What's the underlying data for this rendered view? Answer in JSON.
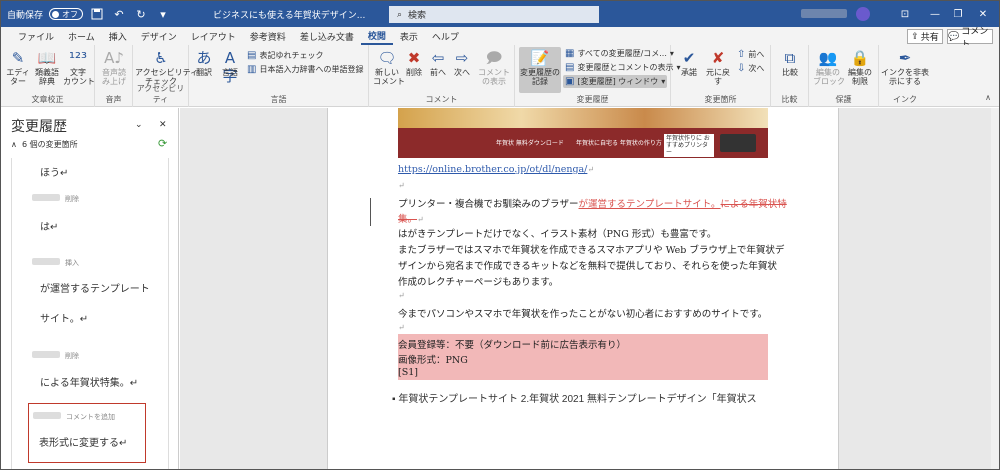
{
  "titlebar": {
    "autosave_label": "自動保存",
    "autosave_state": "オフ",
    "doc_title": "ビジネスにも使える年賀状デザイン...",
    "search_placeholder": "検索"
  },
  "menu": {
    "tabs": [
      "ファイル",
      "ホーム",
      "挿入",
      "デザイン",
      "レイアウト",
      "参考資料",
      "差し込み文書",
      "校閲",
      "表示",
      "ヘルプ"
    ],
    "active": "校閲",
    "share_label": "共有",
    "comment_label": "コメント"
  },
  "ribbon": {
    "proofing": {
      "label": "文章校正",
      "editor": "エディ\nター",
      "thesaurus": "類義語\n辞典",
      "wordcount": "文字\nカウント"
    },
    "speech": {
      "label": "音声",
      "read_aloud": "音声読\nみ上げ"
    },
    "accessibility": {
      "label": "アクセシビリティ",
      "check": "アクセシビリティ\nチェック"
    },
    "language": {
      "label": "言語",
      "translate": "翻訳",
      "language": "言語",
      "notation_check": "表記ゆれチェック",
      "japanese_dict": "日本語入力辞書への単語登録"
    },
    "comments": {
      "label": "コメント",
      "new": "新しい\nコメント",
      "delete": "削除",
      "prev": "前へ",
      "next": "次へ",
      "show": "コメント\nの表示"
    },
    "tracking": {
      "label": "変更履歴",
      "track": "変更履歴の\n記録",
      "all_markup": "すべての変更履歴/コメ...",
      "show_markup": "変更履歴とコメントの表示",
      "window": "[変更履歴] ウィンドウ"
    },
    "changes": {
      "label": "変更箇所",
      "accept": "承諾",
      "reject": "元に戻す",
      "prev": "前へ",
      "next": "次へ"
    },
    "compare": {
      "label": "比較",
      "compare": "比較"
    },
    "protect": {
      "label": "保護",
      "block": "編集の\nブロック",
      "restrict": "編集の\n制限"
    },
    "ink": {
      "label": "インク",
      "hide": "インクを非表\n示にする"
    }
  },
  "pane": {
    "title": "変更履歴",
    "count": "6 個の変更箇所",
    "items": [
      {
        "meta": "",
        "text": "ほう↵"
      },
      {
        "meta": "削除",
        "text": "は↵"
      },
      {
        "meta": "挿入",
        "text": "が運営するテンプレート"
      },
      {
        "meta": "",
        "text": "サイト。↵"
      },
      {
        "meta": "削除",
        "text": "による年賀状特集。↵"
      },
      {
        "meta": "コメントを追加",
        "text": "表形式に変更する↵"
      }
    ]
  },
  "document": {
    "banner": {
      "b1": "年賀状 無料ダウンロード",
      "b2": "年賀状に自宅る 年賀状の作り方",
      "b3": "年賀状作りに おすすめプリンター"
    },
    "link": "https://online.brother.co.jp/ot/dl/nenga/",
    "para1_a": "プリンター・複合機でお馴染みのブラザー",
    "para1_ins": "が運営するテンプレートサイト。",
    "para1_del": "による年賀状特",
    "para1_del2": "集。",
    "para2": "はがきテンプレートだけでなく、イラスト素材（PNG 形式）も豊富です。",
    "para3": "またブラザーではスマホで年賀状を作成できるスマホアプリや Web ブラウザ上で年賀状デ",
    "para4": "ザインから宛名まで作成できるキットなどを無料で提供しており、それらを使った年賀状",
    "para5": "作成のレクチャーページもあります。",
    "para6": "今までパソコンやスマホで年賀状を作ったことがない初心者におすすめのサイトです。",
    "hl1": "会員登録等：不要（ダウンロード前に広告表示有り）",
    "hl2": "画像形式：PNG",
    "hl3": "[S1]",
    "bullet": "年賀状テンプレートサイト 2.年賀状 2021 無料テンプレートデザイン「年賀状ス"
  }
}
